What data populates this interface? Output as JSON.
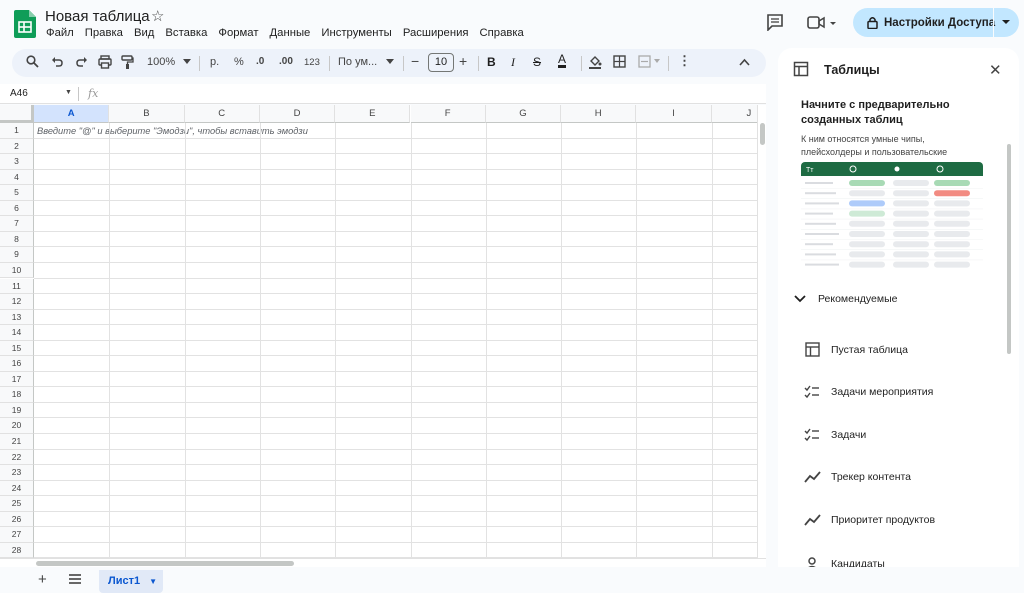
{
  "app": {
    "title": "Новая таблица",
    "menu": [
      "Файл",
      "Правка",
      "Вид",
      "Вставка",
      "Формат",
      "Данные",
      "Инструменты",
      "Расширения",
      "Справка"
    ],
    "share_label": "Настройки Доступа"
  },
  "toolbar": {
    "zoom": "100%",
    "currency": "р.",
    "percent": "%",
    "dec_decrease": ".0",
    "dec_increase": ".00",
    "number_format": "123",
    "font": "По ум...",
    "font_size": "10"
  },
  "formula": {
    "cell_ref": "A46",
    "fx": "fx"
  },
  "grid": {
    "columns": [
      "A",
      "B",
      "C",
      "D",
      "E",
      "F",
      "G",
      "H",
      "I",
      "J"
    ],
    "active_column": "A",
    "rows": [
      "1",
      "2",
      "3",
      "4",
      "5",
      "6",
      "7",
      "8",
      "9",
      "10",
      "11",
      "12",
      "13",
      "14",
      "15",
      "16",
      "17",
      "18",
      "19",
      "20",
      "21",
      "22",
      "23",
      "24",
      "25",
      "26",
      "27",
      "28"
    ],
    "hint_text": "Введите \"@\" и выберите \"Эмодзи\", чтобы вставить эмодзи"
  },
  "sheets": {
    "active": "Лист1"
  },
  "panel": {
    "title": "Таблицы",
    "heading": "Начните с предварительно созданных таблиц",
    "subtext": "К ним относятся умные чипы, плейсхолдеры и пользовательские настройки данных.",
    "section_label": "Рекомендуемые",
    "templates": [
      {
        "label": "Пустая таблица",
        "icon": "table-icon"
      },
      {
        "label": "Задачи мероприятия",
        "icon": "checklist-icon"
      },
      {
        "label": "Задачи",
        "icon": "checklist-icon"
      },
      {
        "label": "Трекер контента",
        "icon": "trend-icon"
      },
      {
        "label": "Приоритет продуктов",
        "icon": "trend-icon"
      },
      {
        "label": "Кандидаты",
        "icon": "person-icon"
      }
    ],
    "preview_header": [
      "Tт"
    ]
  },
  "colors": {
    "accent": "#0b57d0",
    "share_bg": "#c2e7ff",
    "toolbar_bg": "#edf2fa",
    "logo_green": "#0f9d58",
    "preview_header": "#1e6b43"
  }
}
